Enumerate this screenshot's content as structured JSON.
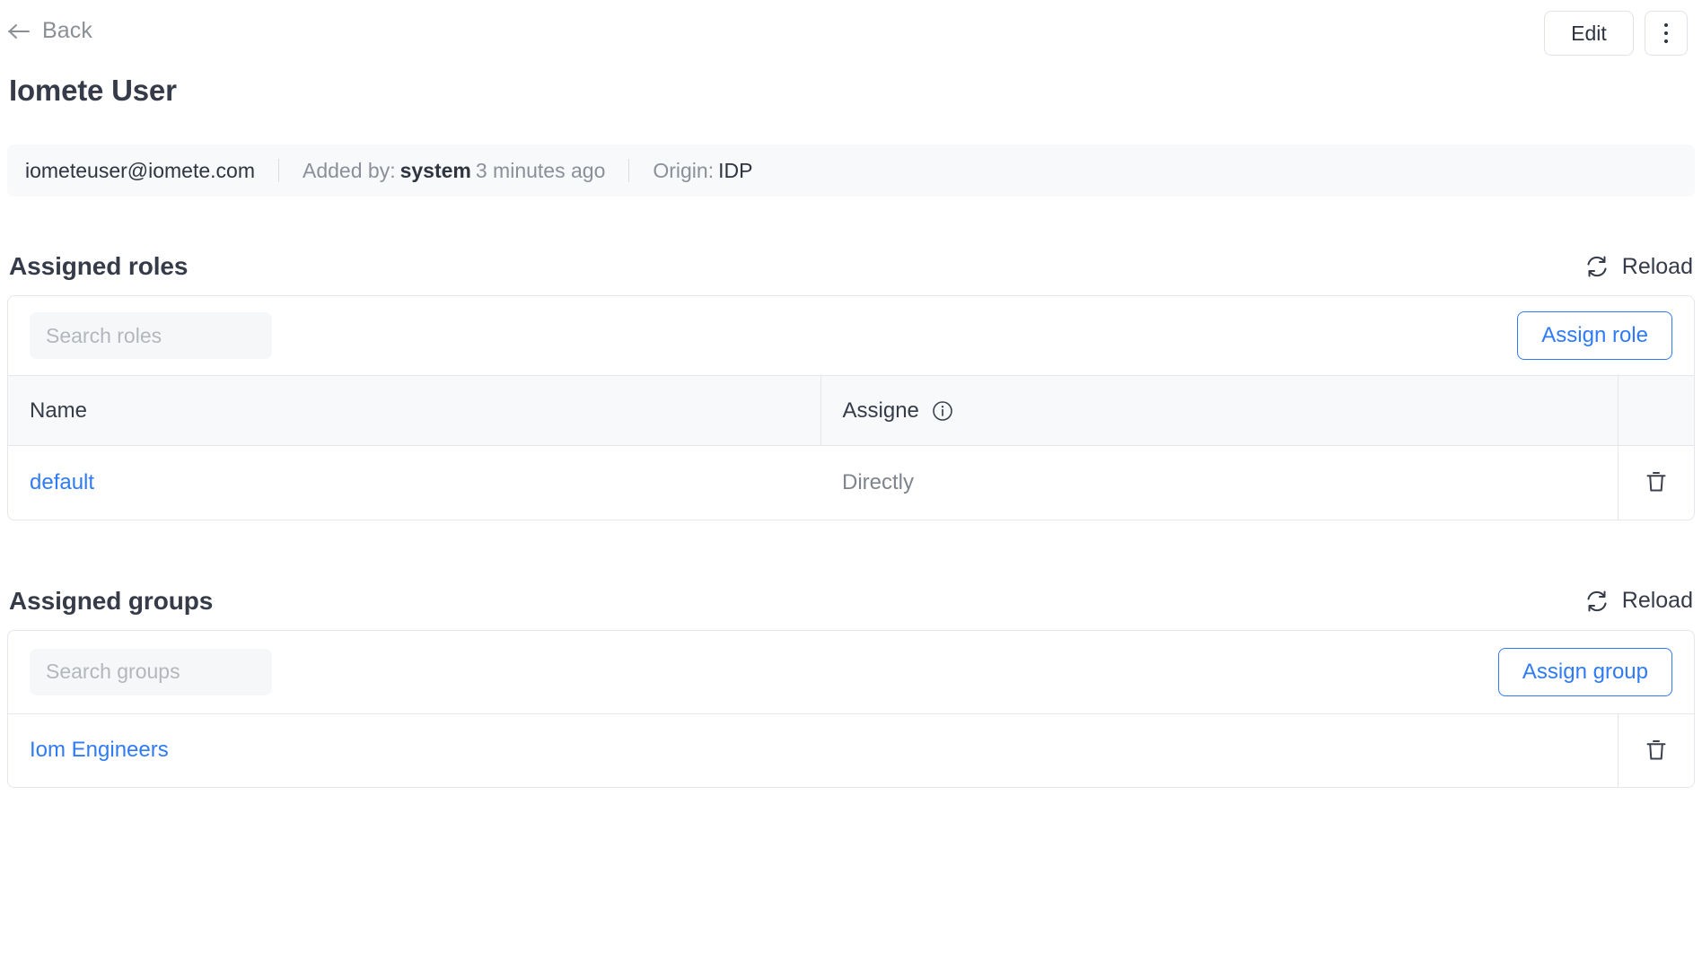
{
  "header": {
    "back_label": "Back",
    "back_icon": "arrow-left-icon",
    "edit_label": "Edit",
    "kebab_icon": "more-vertical-icon",
    "title": "Iomete User"
  },
  "meta": {
    "email": "iometeuser@iomete.com",
    "added_by_label": "Added by:",
    "added_by_value": "system",
    "added_time": "3 minutes ago",
    "origin_label": "Origin:",
    "origin_value": "IDP"
  },
  "roles_section": {
    "title": "Assigned roles",
    "reload_label": "Reload",
    "reload_icon": "refresh-icon",
    "search_placeholder": "Search roles",
    "search_value": "",
    "assign_label": "Assign role",
    "columns": {
      "name": "Name",
      "assigned": "Assigne",
      "assigned_info_icon": "info-circle-icon",
      "actions": ""
    },
    "rows": [
      {
        "name": "default",
        "assigned": "Directly",
        "delete_icon": "trash-icon"
      }
    ]
  },
  "groups_section": {
    "title": "Assigned groups",
    "reload_label": "Reload",
    "reload_icon": "refresh-icon",
    "search_placeholder": "Search groups",
    "search_value": "",
    "assign_label": "Assign group",
    "rows": [
      {
        "name": "Iom Engineers",
        "delete_icon": "trash-icon"
      }
    ]
  },
  "colors": {
    "accent_blue": "#2f7bf6",
    "text_primary": "#353b48",
    "text_muted": "#8a9099",
    "border": "#e4e7eb",
    "surface_muted": "#f8f9fa"
  }
}
